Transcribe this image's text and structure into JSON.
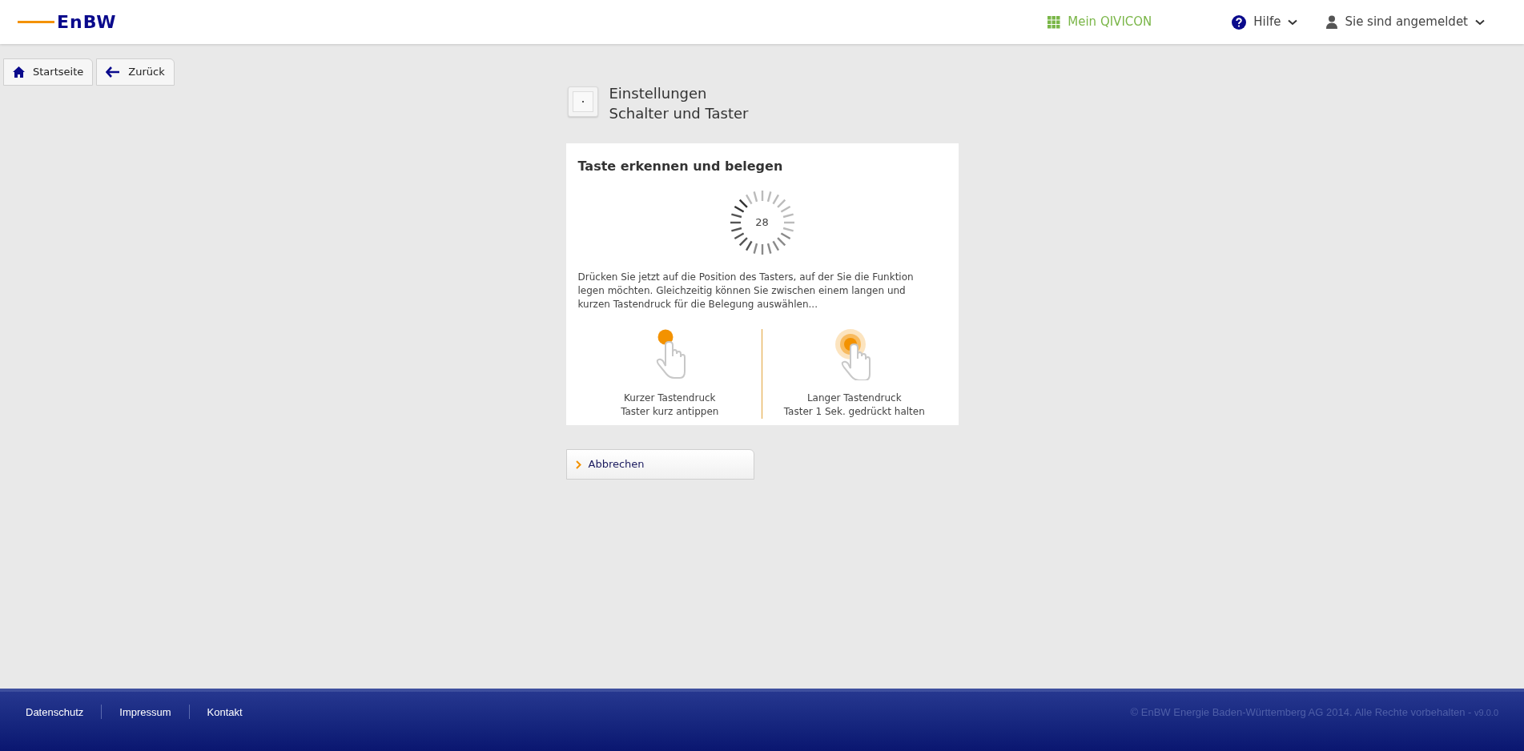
{
  "header": {
    "logo": "EnBW",
    "nav": [
      {
        "kind": "grid",
        "label": "Mein QIVICON"
      },
      {
        "kind": "help",
        "label": "Hilfe"
      },
      {
        "kind": "user",
        "label": "Sie sind angemeldet"
      }
    ]
  },
  "toolbar": [
    {
      "kind": "home",
      "label": "Startseite"
    },
    {
      "kind": "back",
      "label": "Zurück"
    }
  ],
  "page_title": {
    "line_1": "Einstellungen",
    "line_2": "Schalter und Taster"
  },
  "card": {
    "title": "Taste erkennen und belegen",
    "countdown": "28",
    "description": "Drücken Sie jetzt auf die Position des Tasters, auf der Sie die Funktion legen möchten. Gleichzeitig können Sie zwischen einem langen und kurzen Tastendruck für die Belegung auswählen...",
    "options": [
      {
        "kind": "short",
        "title": "Kurzer Tastendruck",
        "hint": "Taster kurz antippen"
      },
      {
        "kind": "long",
        "title": "Langer Tastendruck",
        "hint": "Taster 1 Sek. gedrückt halten"
      }
    ]
  },
  "cancel_button": "Abbrechen",
  "footer": {
    "links": [
      "Datenschutz",
      "Impressum",
      "Kontakt"
    ],
    "copyright": "© EnBW Energie Baden-Württemberg AG 2014. Alle Rechte vorbehalten - ",
    "version": "v9.0.0"
  }
}
